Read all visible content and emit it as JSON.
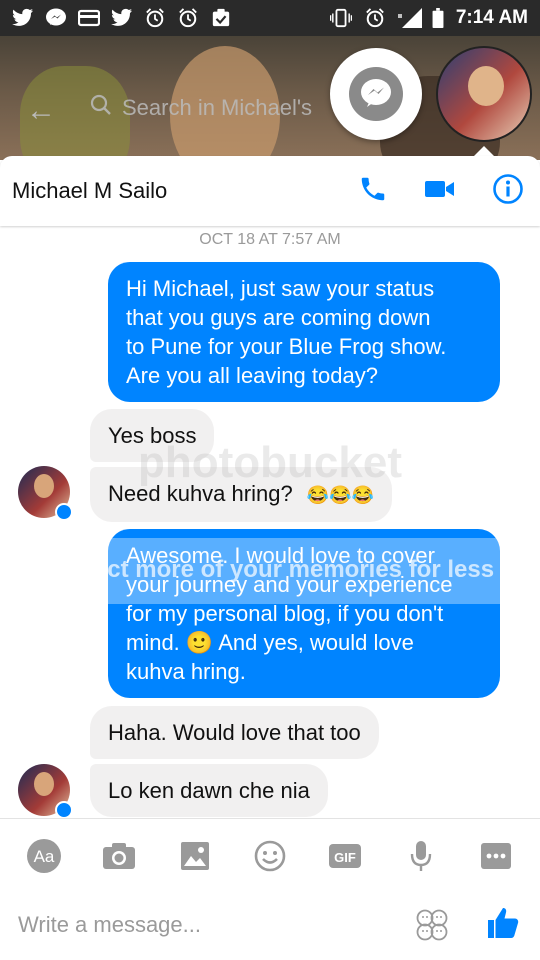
{
  "status_bar": {
    "time": "7:14 AM",
    "icons": [
      "twitter-icon",
      "messenger-icon",
      "card-icon",
      "twitter-icon",
      "alarm-icon",
      "alarm-icon",
      "task-icon",
      "vibrate-icon",
      "alarm-icon",
      "signal-icon",
      "battery-icon"
    ]
  },
  "background": {
    "search_placeholder": "Search in Michael's"
  },
  "header": {
    "contact_name": "Michael M Sailo",
    "accent_color": "#0084ff"
  },
  "conversation": {
    "timestamp": "OCT 18 AT 7:57 AM",
    "messages": [
      {
        "direction": "out",
        "lines": [
          "Hi Michael, just saw your status",
          "that you guys are coming down",
          "to Pune for your Blue Frog show.",
          "Are you all leaving today?"
        ]
      },
      {
        "direction": "in",
        "text": "Yes boss"
      },
      {
        "direction": "in",
        "text": "Need kuhva hring?",
        "emoji": "😂😂😂"
      },
      {
        "direction": "out",
        "lines": [
          "Awesome. I would love to cover",
          "your journey and your experience",
          "for my personal blog, if you don't",
          "mind. 🙂 And yes, would love",
          "kuhva hring."
        ]
      },
      {
        "direction": "in",
        "text": "Haha.  Would love that too"
      },
      {
        "direction": "in",
        "text": "Lo ken dawn che nia"
      }
    ],
    "watermark_main": "photobucket",
    "watermark_protect": "Protect more of your memories for less"
  },
  "composer": {
    "toolbar": [
      "text-size",
      "camera",
      "gallery",
      "emoji",
      "gif",
      "mic",
      "more"
    ],
    "aa_label": "Aa",
    "gif_label": "GIF",
    "placeholder": "Write a message..."
  }
}
